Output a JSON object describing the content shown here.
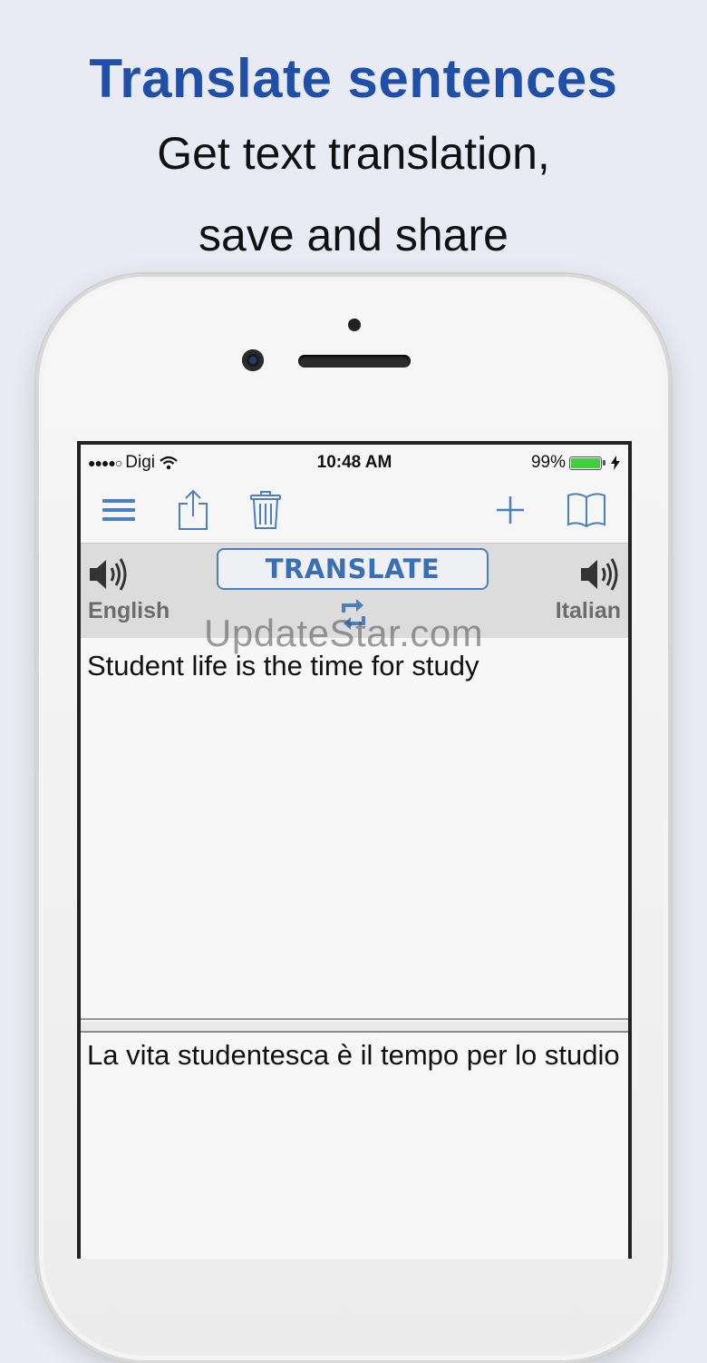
{
  "promo": {
    "title": "Translate sentences",
    "subtitle_line1": "Get text translation,",
    "subtitle_line2": "save and share"
  },
  "status_bar": {
    "carrier": "Digi",
    "signal_dots": "●●●●○",
    "time": "10:48 AM",
    "battery": "99%"
  },
  "toolbar": {
    "icons": [
      "menu-icon",
      "share-icon",
      "trash-icon",
      "plus-icon",
      "book-icon"
    ]
  },
  "language_bar": {
    "translate_label": "TRANSLATE",
    "source_language": "English",
    "target_language": "Italian"
  },
  "watermark": "UpdateStar.com",
  "source_text": "Student life is the time for study",
  "translated_text": "La vita studentesca è il tempo per lo studio",
  "colors": {
    "background": "#e9ebf4",
    "title_blue": "#1f4fa8",
    "icon_blue": "#4a7fc1",
    "battery_green": "#3fcf3f"
  }
}
